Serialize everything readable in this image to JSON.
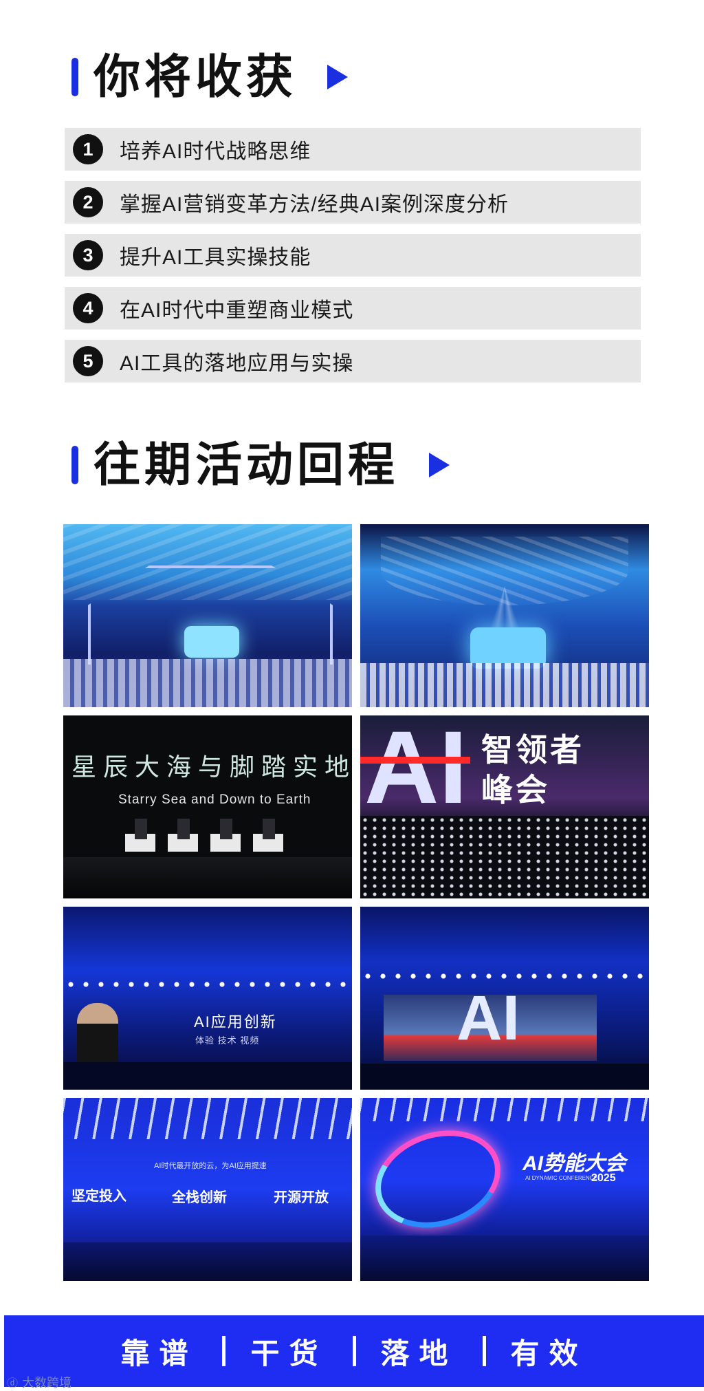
{
  "gains": {
    "title": "你将收获",
    "items": [
      {
        "num": "1",
        "text": "培养AI时代战略思维"
      },
      {
        "num": "2",
        "text": "掌握AI营销变革方法/经典AI案例深度分析"
      },
      {
        "num": "3",
        "text": "提升AI工具实操技能"
      },
      {
        "num": "4",
        "text": "在AI时代中重塑商业模式"
      },
      {
        "num": "5",
        "text": "AI工具的落地应用与实操"
      }
    ]
  },
  "review": {
    "title": "往期活动回程",
    "photos": {
      "p3_line1": "星辰大海与脚踏实地",
      "p3_line2": "Starry Sea and Down to Earth",
      "p4_big": "AI",
      "p4_line1": "智领者",
      "p4_line2": "峰会",
      "p5_title": "AI应用创新",
      "p5_sub": "体验   技术   视频",
      "p6_big": "AI",
      "p7_top": "AI时代最开放的云，为AI应用提速",
      "p7_w1": "坚定投入",
      "p7_w2": "全栈创新",
      "p7_w3": "开源开放",
      "p8_title": "AI势能大会",
      "p8_sub": "AI DYNAMIC CONFERENCE",
      "p8_year": "2025"
    }
  },
  "footer": {
    "words": [
      "靠谱",
      "干货",
      "落地",
      "有效"
    ]
  },
  "watermark": "大数跨境",
  "colors": {
    "accent": "#1a2fe0",
    "footer_bg": "#1f2cf2"
  }
}
